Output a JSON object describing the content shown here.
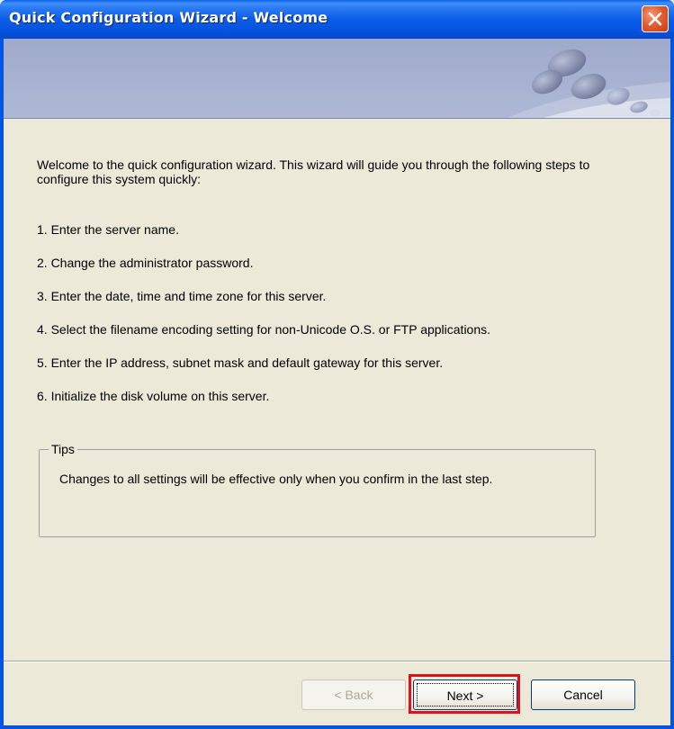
{
  "window": {
    "title": "Quick Configuration Wizard - Welcome"
  },
  "intro": "Welcome to the quick configuration wizard. This wizard will guide you through the following steps to configure this system quickly:",
  "steps": [
    "1. Enter the server name.",
    "2. Change the administrator password.",
    "3. Enter the date, time and time zone for this server.",
    "4. Select the filename encoding setting for non-Unicode O.S. or FTP applications.",
    "5. Enter the IP address, subnet mask and default gateway for this server.",
    "6. Initialize the disk volume on this server."
  ],
  "tips": {
    "legend": "Tips",
    "text": "Changes to all settings will be effective only when you confirm in the last step."
  },
  "buttons": {
    "back": "< Back",
    "next": "Next >",
    "cancel": "Cancel"
  },
  "icons": {
    "close": "close-icon",
    "banner": "banner-graphic"
  },
  "colors": {
    "titlebar": "#0054E3",
    "highlight": "#E0101C",
    "dialog_bg": "#ECE9D8"
  },
  "state": {
    "back_enabled": false,
    "focused_button": "next"
  }
}
